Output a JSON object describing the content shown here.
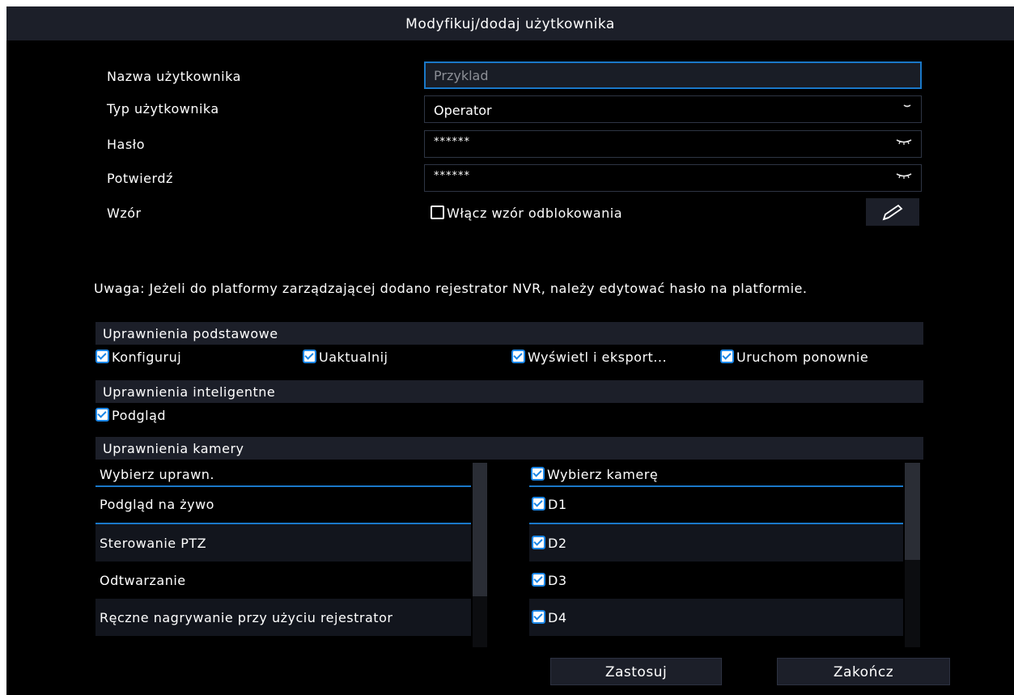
{
  "dialog": {
    "title": "Modyfikuj/dodaj użytkownika"
  },
  "form": {
    "username_label": "Nazwa użytkownika",
    "username_placeholder": "Przyklad",
    "usertype_label": "Typ użytkownika",
    "usertype_value": "Operator",
    "password_label": "Hasło",
    "password_value": "******",
    "confirm_label": "Potwierdź",
    "confirm_value": "******",
    "pattern_label": "Wzór",
    "pattern_checkbox_label": "Włącz wzór odblokowania",
    "pattern_checked": false
  },
  "note": "Uwaga: Jeżeli do platformy zarządzającej dodano rejestrator NVR, należy edytować hasło na platformie.",
  "basic_permissions": {
    "title": "Uprawnienia podstawowe",
    "items": [
      "Konfiguruj",
      "Uaktualnij",
      "Wyświetl i eksport...",
      "Uruchom ponownie"
    ]
  },
  "smart_permissions": {
    "title": "Uprawnienia inteligentne",
    "items": [
      "Podgląd"
    ]
  },
  "camera_permissions": {
    "title": "Uprawnienia kamery",
    "left_header": "Wybierz uprawn.",
    "left_items": [
      "Podgląd na żywo",
      "Sterowanie PTZ",
      "Odtwarzanie",
      "Ręczne nagrywanie przy użyciu rejestrator"
    ],
    "right_header": "Wybierz kamerę",
    "right_items": [
      "D1",
      "D2",
      "D3",
      "D4"
    ]
  },
  "buttons": {
    "apply": "Zastosuj",
    "finish": "Zakończ"
  },
  "icons": {
    "dropdown": "chevron-down-icon",
    "eye": "eye-closed-icon",
    "pencil": "pencil-icon"
  },
  "colors": {
    "accent": "#1a78c8",
    "panel": "#1c1f29",
    "background": "#000000"
  }
}
